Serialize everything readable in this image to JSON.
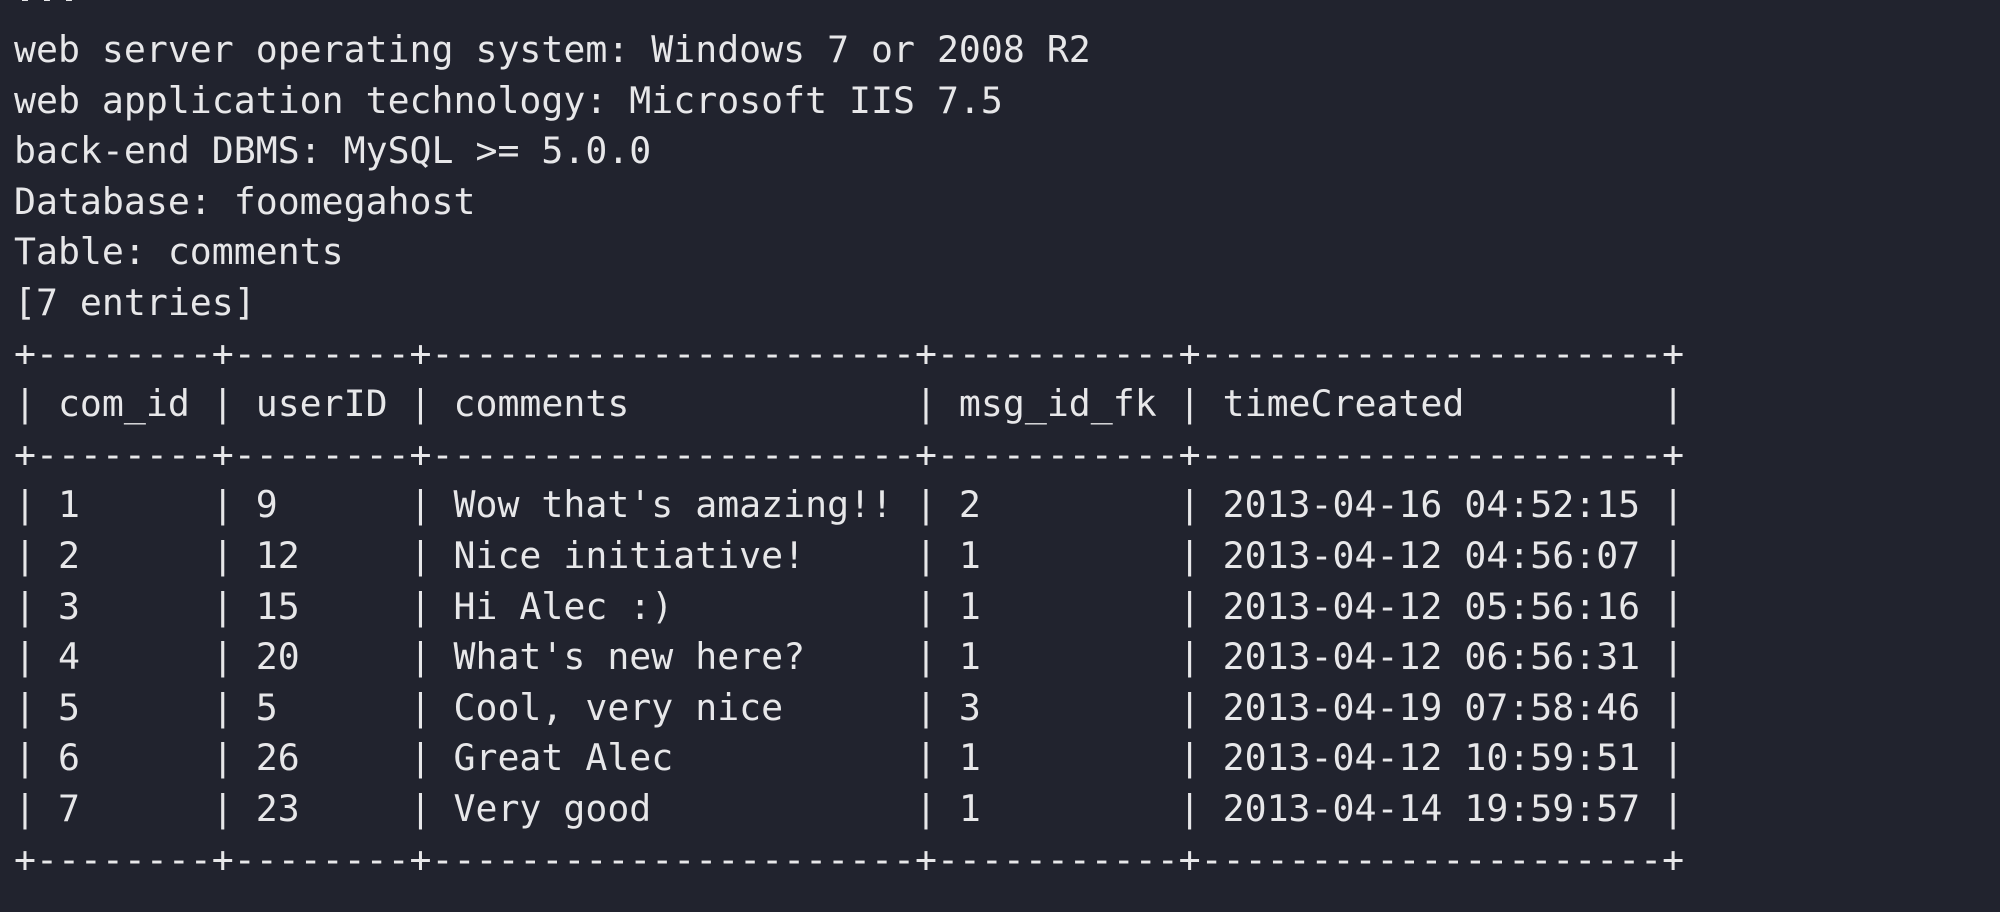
{
  "terminal": {
    "scrolled_remnant": "...",
    "info_lines": [
      "web server operating system: Windows 7 or 2008 R2",
      "web application technology: Microsoft IIS 7.5",
      "back-end DBMS: MySQL >= 5.0.0",
      "Database: foomegahost",
      "Table: comments",
      "[7 entries]"
    ],
    "table": {
      "border": "+--------+--------+----------------------+-----------+---------------------+",
      "header": "| com_id | userID | comments             | msg_id_fk | timeCreated         |",
      "columns": [
        "com_id",
        "userID",
        "comments",
        "msg_id_fk",
        "timeCreated"
      ],
      "rows": [
        "| 1      | 9      | Wow that's amazing!! | 2         | 2013-04-16 04:52:15 |",
        "| 2      | 12     | Nice initiative!     | 1         | 2013-04-12 04:56:07 |",
        "| 3      | 15     | Hi Alec :)           | 1         | 2013-04-12 05:56:16 |",
        "| 4      | 20     | What's new here?     | 1         | 2013-04-12 06:56:31 |",
        "| 5      | 5      | Cool, very nice      | 3         | 2013-04-19 07:58:46 |",
        "| 6      | 26     | Great Alec           | 1         | 2013-04-12 10:59:51 |",
        "| 7      | 23     | Very good            | 1         | 2013-04-14 19:59:57 |"
      ],
      "row_values": [
        [
          "1",
          "9",
          "Wow that's amazing!!",
          "2",
          "2013-04-16 04:52:15"
        ],
        [
          "2",
          "12",
          "Nice initiative!",
          "1",
          "2013-04-12 04:56:07"
        ],
        [
          "3",
          "15",
          "Hi Alec :)",
          "1",
          "2013-04-12 05:56:16"
        ],
        [
          "4",
          "20",
          "What's new here?",
          "1",
          "2013-04-12 06:56:31"
        ],
        [
          "5",
          "5",
          "Cool, very nice",
          "3",
          "2013-04-19 07:58:46"
        ],
        [
          "6",
          "26",
          "Great Alec",
          "1",
          "2013-04-12 10:59:51"
        ],
        [
          "7",
          "23",
          "Very good",
          "1",
          "2013-04-14 19:59:57"
        ]
      ]
    },
    "colors": {
      "background": "#21232e",
      "foreground": "#e7e7e9"
    }
  }
}
